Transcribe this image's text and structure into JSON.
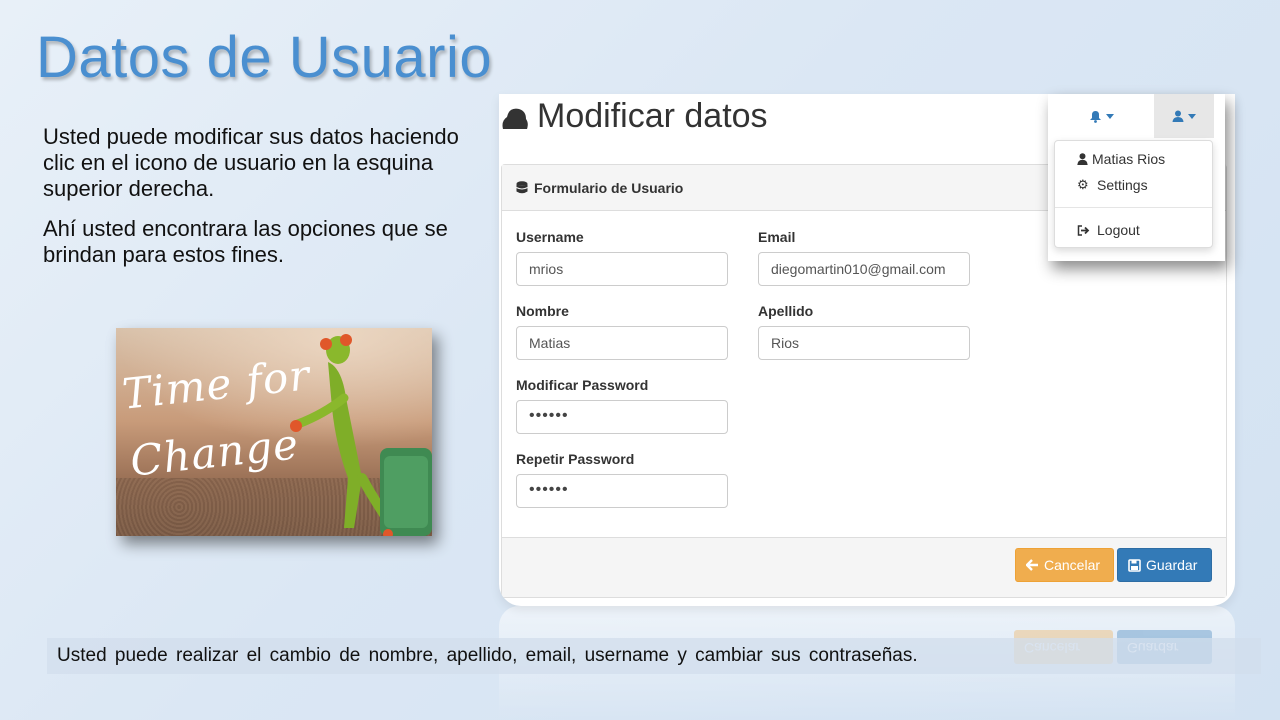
{
  "slide": {
    "title": "Datos de Usuario",
    "intro_p1": "Usted puede modificar sus datos haciendo clic en el icono de usuario en la esquina superior derecha.",
    "intro_p2": "Ahí usted encontrara las opciones que se brindan para estos fines.",
    "footer": "Usted puede realizar el cambio de nombre, apellido, email, username y cambiar sus contraseñas."
  },
  "image": {
    "line1": "Time for",
    "line2": "Change"
  },
  "page": {
    "title": "Modificar datos"
  },
  "form": {
    "heading": "Formulario de Usuario",
    "fields": [
      {
        "label": "Username",
        "value": "mrios"
      },
      {
        "label": "Email",
        "value": "diegomartin010@gmail.com"
      },
      {
        "label": "Nombre",
        "value": "Matias"
      },
      {
        "label": "Apellido",
        "value": "Rios"
      },
      {
        "label": "Modificar Password",
        "value": "••••••"
      },
      {
        "label": "Repetir Password",
        "value": "••••••"
      }
    ],
    "cancel_label": "Cancelar",
    "save_label": "Guardar"
  },
  "user_menu": {
    "items": [
      "Matias Rios",
      "Settings",
      "Logout"
    ]
  },
  "colors": {
    "title": "#4a8fd0",
    "primary": "#337ab7",
    "warning": "#f0ad4e"
  }
}
